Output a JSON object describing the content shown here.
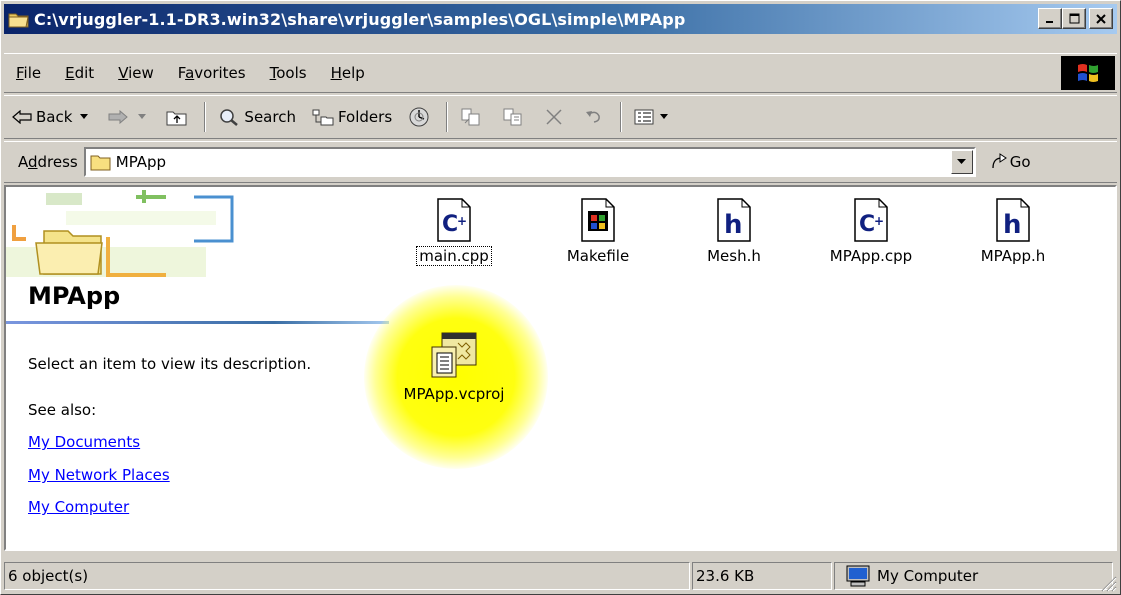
{
  "window": {
    "title": "C:\\vrjuggler-1.1-DR3.win32\\share\\vrjuggler\\samples\\OGL\\simple\\MPApp",
    "minimize": "_",
    "maximize": "□",
    "close": "×"
  },
  "menu": {
    "items": [
      {
        "key": "F",
        "rest": "ile"
      },
      {
        "key": "E",
        "rest": "dit"
      },
      {
        "key": "V",
        "rest": "iew"
      },
      {
        "pre": "F",
        "key": "a",
        "rest": "vorites"
      },
      {
        "key": "T",
        "rest": "ools"
      },
      {
        "key": "H",
        "rest": "elp"
      }
    ]
  },
  "toolbar": {
    "back": "Back",
    "search": "Search",
    "folders": "Folders"
  },
  "address": {
    "label_pre": "A",
    "label_key": "d",
    "label_rest": "dress",
    "value": "MPApp",
    "go": "Go"
  },
  "leftpane": {
    "folder_title": "MPApp",
    "description": "Select an item to view its description.",
    "see_also": "See also:",
    "links": [
      "My Documents",
      "My Network Places",
      "My Computer"
    ]
  },
  "files": [
    {
      "name": "main.cpp",
      "icon": "cpp-file-icon"
    },
    {
      "name": "Makefile",
      "icon": "makefile-icon"
    },
    {
      "name": "Mesh.h",
      "icon": "header-file-icon"
    },
    {
      "name": "MPApp.cpp",
      "icon": "cpp-file-icon"
    },
    {
      "name": "MPApp.h",
      "icon": "header-file-icon"
    },
    {
      "name": "MPApp.vcproj",
      "icon": "vcproj-file-icon"
    }
  ],
  "status": {
    "objects": "6 object(s)",
    "size": "23.6 KB",
    "zone": "My Computer"
  },
  "colors": {
    "title_gradient_start": "#0a246a",
    "title_gradient_end": "#a6caf0",
    "highlight_glow": "#ffff00",
    "link": "#0000ff"
  }
}
